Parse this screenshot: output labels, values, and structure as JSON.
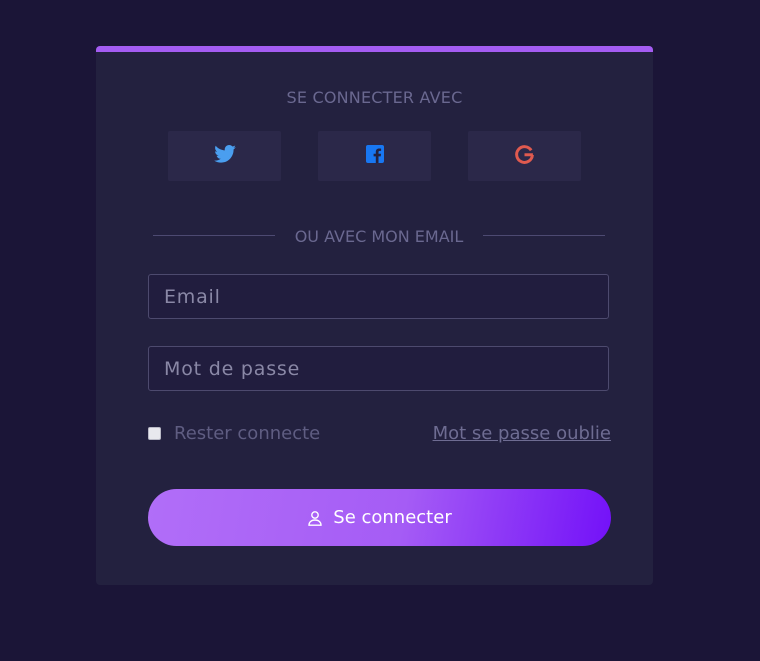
{
  "social": {
    "title": "SE CONNECTER AVEC",
    "buttons": [
      {
        "name": "twitter",
        "icon": "twitter-icon",
        "color": "#4a9eef"
      },
      {
        "name": "facebook",
        "icon": "facebook-icon",
        "color": "#1877f2"
      },
      {
        "name": "google",
        "icon": "google-icon",
        "color": "#e05a4f"
      }
    ]
  },
  "divider": {
    "text": "OU AVEC MON EMAIL"
  },
  "form": {
    "email_placeholder": "Email",
    "password_placeholder": "Mot de passe",
    "remember_label": "Rester connecte",
    "forgot_label": "Mot se passe oublie",
    "submit_label": "Se connecter"
  },
  "colors": {
    "background": "#1b1537",
    "card": "#23213f",
    "accent": "#a45cf2"
  }
}
